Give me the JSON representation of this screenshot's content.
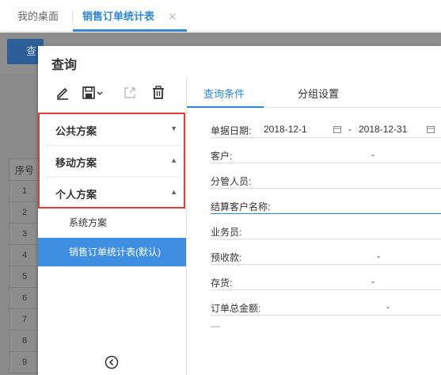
{
  "tabbar": {
    "home_tab": "我的桌面",
    "active_tab": "销售订单统计表",
    "close_glyph": "✕"
  },
  "background": {
    "query_button": "查",
    "grid_header": "序号",
    "row_numbers": [
      "1",
      "2",
      "3",
      "4",
      "5",
      "6",
      "7",
      "8",
      "9"
    ]
  },
  "dialog": {
    "title": "查询",
    "toolbar_icons": [
      "edit-icon",
      "save-icon",
      "export-icon",
      "delete-icon"
    ],
    "left": {
      "groups": [
        {
          "label": "公共方案",
          "state": "collapsed"
        },
        {
          "label": "移动方案",
          "state": "expanded"
        },
        {
          "label": "个人方案",
          "state": "expanded"
        }
      ],
      "items": [
        {
          "label": "系统方案",
          "selected": false
        },
        {
          "label": "销售订单统计表(默认)",
          "selected": true
        }
      ],
      "highlight_color": "#e03c3c",
      "selected_color": "#3e8ee2"
    },
    "right": {
      "tabs": [
        {
          "label": "查询条件",
          "active": true
        },
        {
          "label": "分组设置",
          "active": false
        }
      ],
      "fields": [
        {
          "label": "单据日期:",
          "type": "daterange",
          "from": "2018-12-1",
          "separator": "-",
          "to": "2018-12-31"
        },
        {
          "label": "客户:",
          "type": "range",
          "separator": "-"
        },
        {
          "label": "分管人员:",
          "type": "text"
        },
        {
          "label": "结算客户名称:",
          "type": "text",
          "focused": true
        },
        {
          "label": "业务员:",
          "type": "text"
        },
        {
          "label": "预收款:",
          "type": "range",
          "separator": "-"
        },
        {
          "label": "存货:",
          "type": "range",
          "separator": "-"
        },
        {
          "label": "订单总金额:",
          "type": "range",
          "separator": "-"
        }
      ],
      "more_line": "—",
      "accent_color": "#2f87d6"
    }
  }
}
